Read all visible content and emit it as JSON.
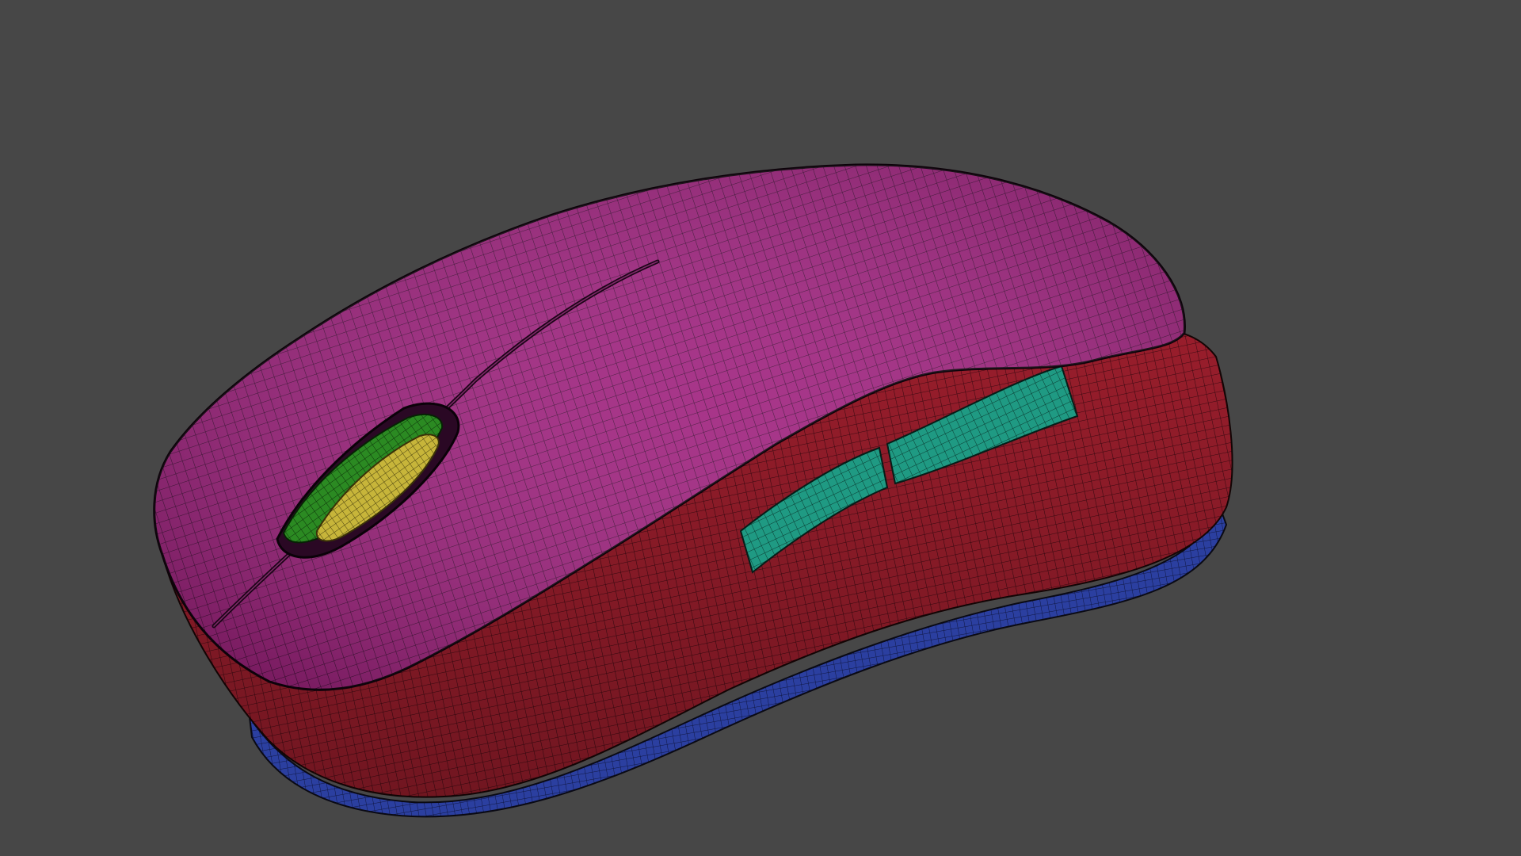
{
  "scene": {
    "background_color": "#474747",
    "subject": "wireframe-mouse-model",
    "shading": "wireframe-over-solid",
    "wire_color": "#1a0e1a"
  },
  "mesh_parts": [
    {
      "name": "top-shell",
      "color": "#a0237f"
    },
    {
      "name": "side-body",
      "color": "#a11f2e"
    },
    {
      "name": "base-plate",
      "color": "#2b3fa0"
    },
    {
      "name": "side-buttons",
      "color": "#1f9a83"
    },
    {
      "name": "scroll-wheel",
      "color": "#2b8a22"
    },
    {
      "name": "scroll-wheel-core",
      "color": "#c7b53a"
    }
  ]
}
